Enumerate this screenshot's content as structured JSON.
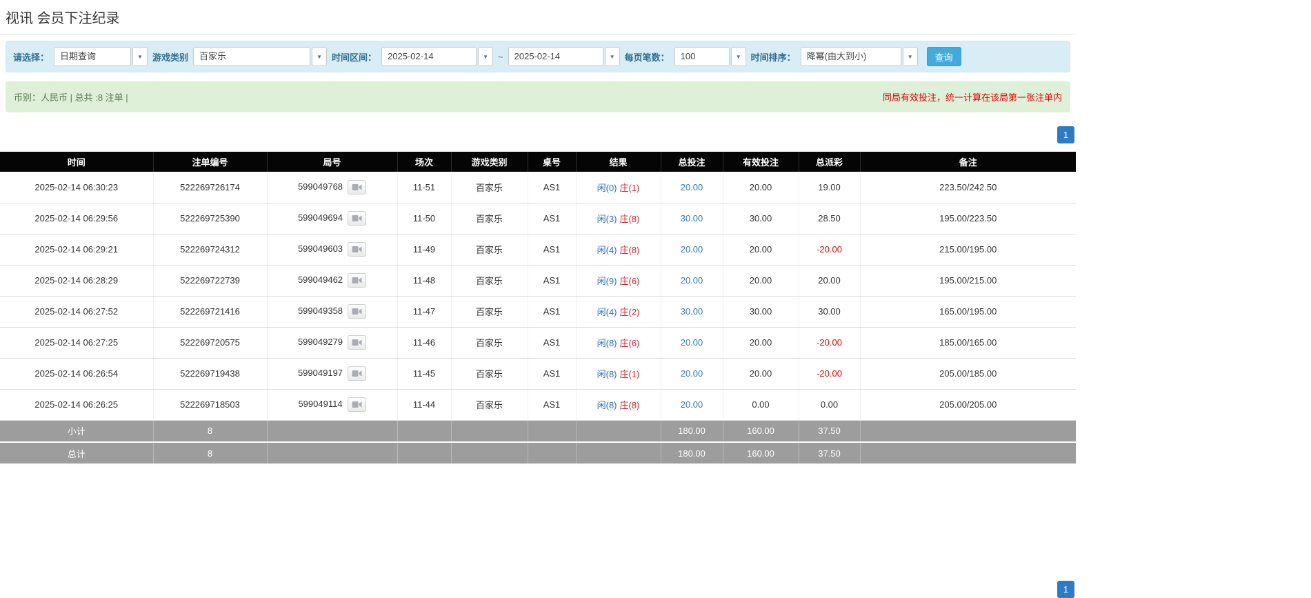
{
  "page": {
    "title": "视讯 会员下注纪录"
  },
  "colors": {
    "link-blue": "#337ab7",
    "player-blue": "#2a6fc9",
    "banker-red": "#d9232d",
    "warning-red": "#e60000",
    "button-blue": "#42aadd",
    "pager-blue": "#2d7cc1"
  },
  "filters": {
    "select_label": "请选择：",
    "select_value": "日期查询",
    "game_type_label": "游戏类别",
    "game_type_value": "百家乐",
    "time_range_label": "时间区间：",
    "date_from": "2025-02-14",
    "tilde": "~",
    "date_to": "2025-02-14",
    "page_size_label": "每页笔数：",
    "page_size_value": "100",
    "sort_label": "时间排序：",
    "sort_value": "降幂(由大到小)",
    "query_button": "查询"
  },
  "summary": {
    "left": "币别：人民币 | 总共 :8 注单 |",
    "right": "同局有效投注，统一计算在该局第一张注单内"
  },
  "pagination": {
    "page": "1"
  },
  "table": {
    "headers": [
      "时间",
      "注单编号",
      "局号",
      "场次",
      "游戏类别",
      "桌号",
      "结果",
      "总投注",
      "有效投注",
      "总派彩",
      "备注"
    ],
    "rows": [
      {
        "time": "2025-02-14 06:30:23",
        "bet_id": "522269726174",
        "round": "599049768",
        "session": "11-51",
        "game": "百家乐",
        "table": "AS1",
        "result_player": "闲(0)",
        "result_banker": "庄(1)",
        "total_bet": "20.00",
        "valid_bet": "20.00",
        "payout": "19.00",
        "note": "223.50/242.50"
      },
      {
        "time": "2025-02-14 06:29:56",
        "bet_id": "522269725390",
        "round": "599049694",
        "session": "11-50",
        "game": "百家乐",
        "table": "AS1",
        "result_player": "闲(3)",
        "result_banker": "庄(8)",
        "total_bet": "30.00",
        "valid_bet": "30.00",
        "payout": "28.50",
        "note": "195.00/223.50"
      },
      {
        "time": "2025-02-14 06:29:21",
        "bet_id": "522269724312",
        "round": "599049603",
        "session": "11-49",
        "game": "百家乐",
        "table": "AS1",
        "result_player": "闲(4)",
        "result_banker": "庄(8)",
        "total_bet": "20.00",
        "valid_bet": "20.00",
        "payout": "-20.00",
        "note": "215.00/195.00"
      },
      {
        "time": "2025-02-14 06:28:29",
        "bet_id": "522269722739",
        "round": "599049462",
        "session": "11-48",
        "game": "百家乐",
        "table": "AS1",
        "result_player": "闲(9)",
        "result_banker": "庄(6)",
        "total_bet": "20.00",
        "valid_bet": "20.00",
        "payout": "20.00",
        "note": "195.00/215.00"
      },
      {
        "time": "2025-02-14 06:27:52",
        "bet_id": "522269721416",
        "round": "599049358",
        "session": "11-47",
        "game": "百家乐",
        "table": "AS1",
        "result_player": "闲(4)",
        "result_banker": "庄(2)",
        "total_bet": "30.00",
        "valid_bet": "30.00",
        "payout": "30.00",
        "note": "165.00/195.00"
      },
      {
        "time": "2025-02-14 06:27:25",
        "bet_id": "522269720575",
        "round": "599049279",
        "session": "11-46",
        "game": "百家乐",
        "table": "AS1",
        "result_player": "闲(8)",
        "result_banker": "庄(6)",
        "total_bet": "20.00",
        "valid_bet": "20.00",
        "payout": "-20.00",
        "note": "185.00/165.00"
      },
      {
        "time": "2025-02-14 06:26:54",
        "bet_id": "522269719438",
        "round": "599049197",
        "session": "11-45",
        "game": "百家乐",
        "table": "AS1",
        "result_player": "闲(8)",
        "result_banker": "庄(1)",
        "total_bet": "20.00",
        "valid_bet": "20.00",
        "payout": "-20.00",
        "note": "205.00/185.00"
      },
      {
        "time": "2025-02-14 06:26:25",
        "bet_id": "522269718503",
        "round": "599049114",
        "session": "11-44",
        "game": "百家乐",
        "table": "AS1",
        "result_player": "闲(8)",
        "result_banker": "庄(8)",
        "total_bet": "20.00",
        "valid_bet": "0.00",
        "payout": "0.00",
        "note": "205.00/205.00"
      }
    ],
    "subtotal": {
      "label": "小计",
      "count": "8",
      "total_bet": "180.00",
      "valid_bet": "160.00",
      "payout": "37.50"
    },
    "total": {
      "label": "总计",
      "count": "8",
      "total_bet": "180.00",
      "valid_bet": "160.00",
      "payout": "37.50"
    }
  }
}
